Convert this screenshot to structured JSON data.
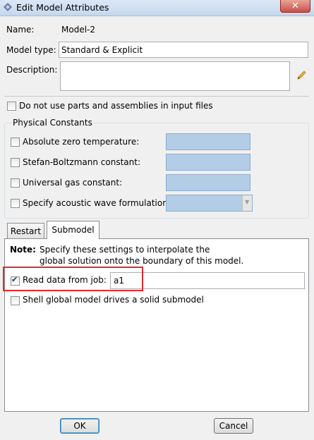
{
  "window": {
    "title": "Edit Model Attributes"
  },
  "name": {
    "label": "Name:",
    "value": "Model-2"
  },
  "model_type": {
    "label": "Model type:",
    "value": "Standard & Explicit"
  },
  "description": {
    "label": "Description:",
    "value": ""
  },
  "no_parts": {
    "label": "Do not use parts and assemblies in input files",
    "checked": false
  },
  "physical_constants": {
    "title": "Physical Constants",
    "items": [
      {
        "label": "Absolute zero temperature:",
        "checked": false
      },
      {
        "label": "Stefan-Boltzmann constant:",
        "checked": false
      },
      {
        "label": "Universal gas constant:",
        "checked": false
      },
      {
        "label": "Specify acoustic wave formulation:",
        "checked": false
      }
    ]
  },
  "tabs": [
    {
      "label": "Restart",
      "active": false
    },
    {
      "label": "Submodel",
      "active": true
    }
  ],
  "submodel": {
    "note_label": "Note:",
    "note_line1": "Specify these settings to interpolate the",
    "note_line2": "global solution onto the boundary of this model.",
    "read_data_label": "Read data from job:",
    "read_data_checked": true,
    "job_value": "a1",
    "shell_label": "Shell global model drives a solid submodel",
    "shell_checked": false
  },
  "buttons": {
    "ok": "OK",
    "cancel": "Cancel"
  },
  "colors": {
    "highlight": "#e8282c",
    "field_disabled": "#b3cde7"
  }
}
